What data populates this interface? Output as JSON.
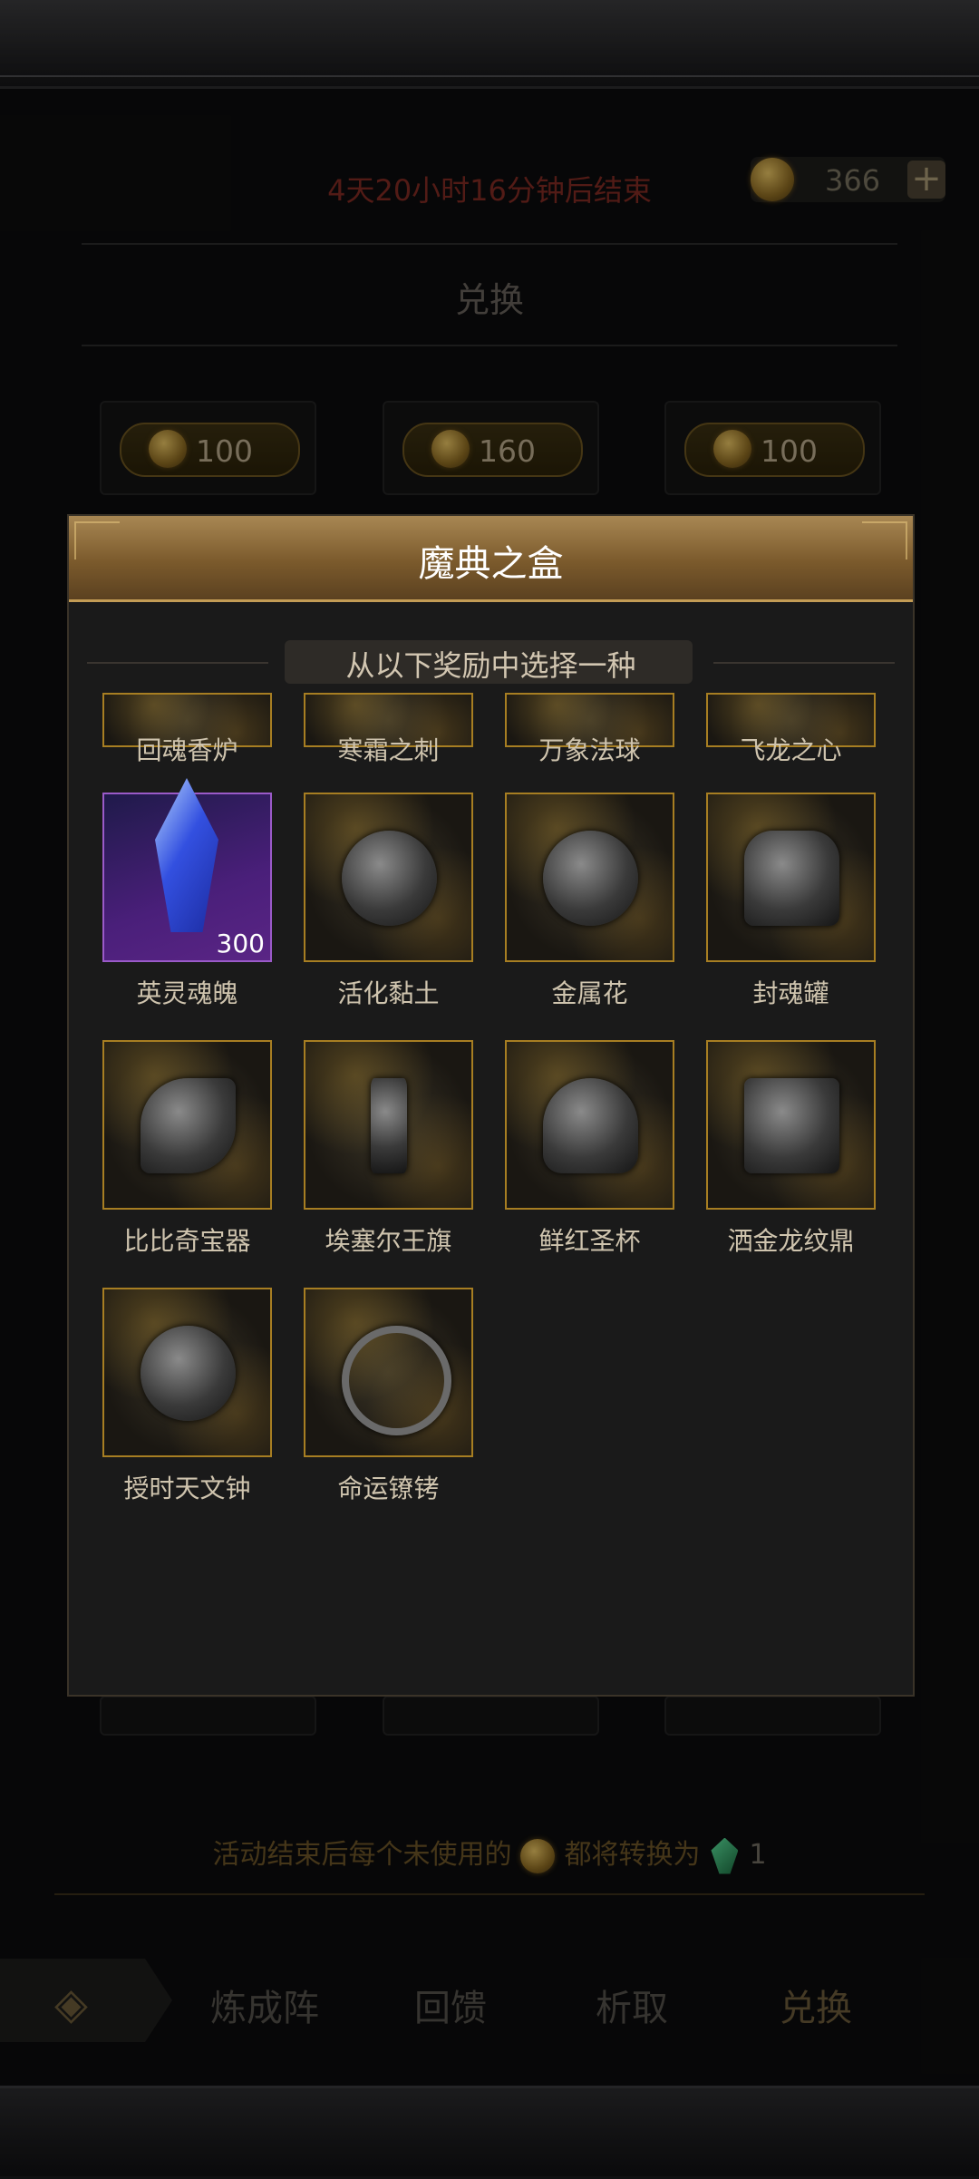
{
  "event": {
    "timer_text": "4天20小时16分钟后结束",
    "currency_count": "366",
    "tab_title": "兑换",
    "prices": [
      "100",
      "160",
      "100"
    ],
    "note_prefix": "活动结束后每个未使用的",
    "note_mid": "都将转换为",
    "note_count": "1"
  },
  "nav": {
    "items": [
      "炼成阵",
      "回馈",
      "析取",
      "兑换"
    ],
    "active": "兑换"
  },
  "modal": {
    "title": "魔典之盒",
    "subtitle": "从以下奖励中选择一种",
    "rewards": [
      {
        "name": "回魂香炉"
      },
      {
        "name": "寒霜之刺"
      },
      {
        "name": "万象法球"
      },
      {
        "name": "飞龙之心"
      },
      {
        "name": "英灵魂魄",
        "quantity": "300",
        "rarity": "purple"
      },
      {
        "name": "活化黏土"
      },
      {
        "name": "金属花"
      },
      {
        "name": "封魂罐"
      },
      {
        "name": "比比奇宝器"
      },
      {
        "name": "埃塞尔王旗"
      },
      {
        "name": "鲜红圣杯"
      },
      {
        "name": "洒金龙纹鼎"
      },
      {
        "name": "授时天文钟"
      },
      {
        "name": "命运镣铐"
      }
    ]
  },
  "colors": {
    "gold_border": "#a77e22",
    "purple_border": "#9a5ac8",
    "header_gold": "#a88753",
    "timer_red": "#7e2a22"
  }
}
